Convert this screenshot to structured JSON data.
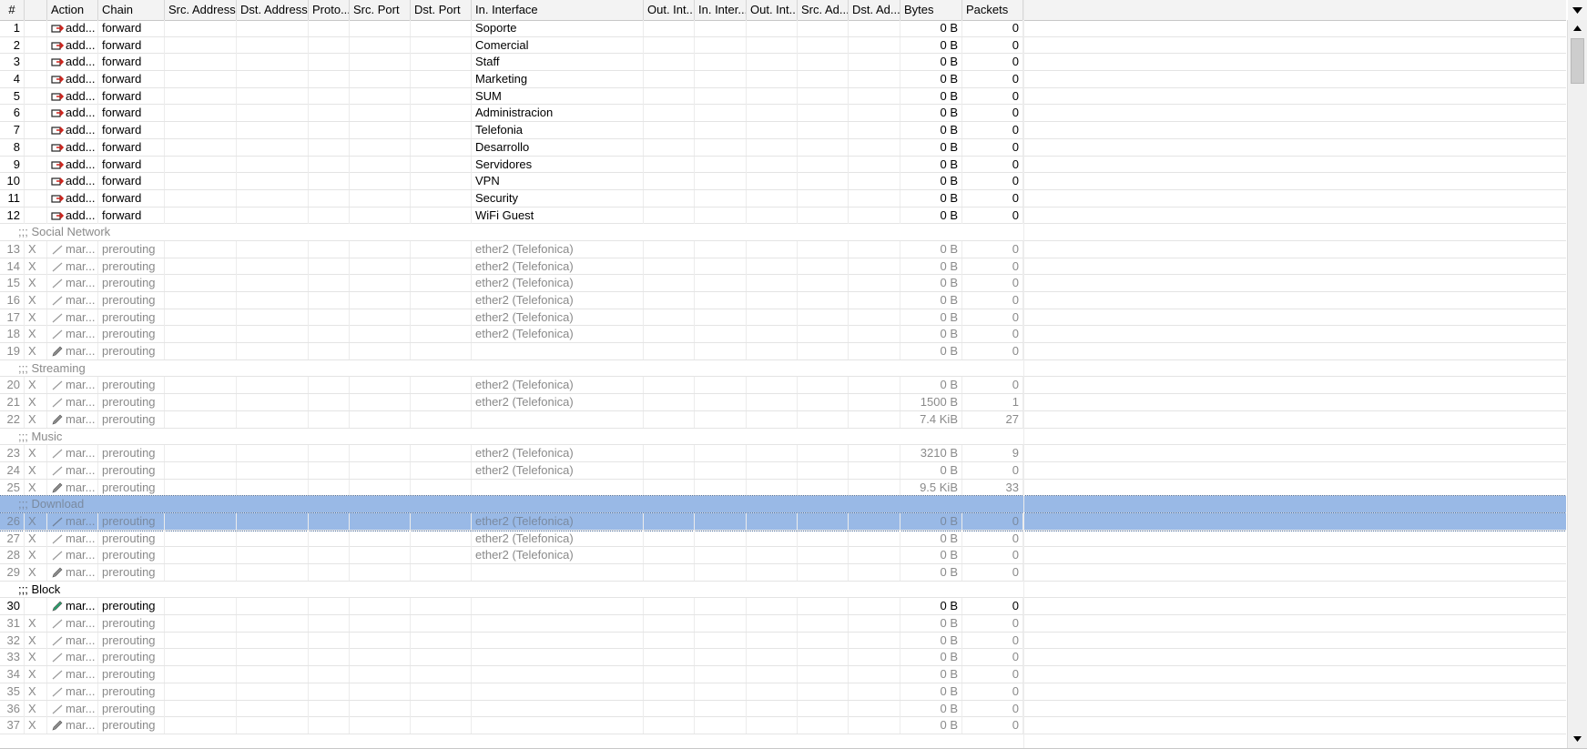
{
  "columns": [
    {
      "key": "num",
      "label": "#"
    },
    {
      "key": "flag",
      "label": ""
    },
    {
      "key": "action",
      "label": "Action"
    },
    {
      "key": "chain",
      "label": "Chain"
    },
    {
      "key": "src_address",
      "label": "Src. Address"
    },
    {
      "key": "dst_address",
      "label": "Dst. Address"
    },
    {
      "key": "proto",
      "label": "Proto..."
    },
    {
      "key": "src_port",
      "label": "Src. Port"
    },
    {
      "key": "dst_port",
      "label": "Dst. Port"
    },
    {
      "key": "in_interface",
      "label": "In. Interface"
    },
    {
      "key": "out_int",
      "label": "Out. Int..."
    },
    {
      "key": "in_inter",
      "label": "In. Inter..."
    },
    {
      "key": "out_int2",
      "label": "Out. Int..."
    },
    {
      "key": "src_ad",
      "label": "Src. Ad..."
    },
    {
      "key": "dst_ad",
      "label": "Dst. Ad..."
    },
    {
      "key": "bytes",
      "label": "Bytes"
    },
    {
      "key": "packets",
      "label": "Packets"
    }
  ],
  "rows": [
    {
      "type": "rule",
      "num": "1",
      "flag": "",
      "action": "add...",
      "icon": "add-icon",
      "chain": "forward",
      "in_interface": "Soporte",
      "bytes": "0 B",
      "packets": "0",
      "disabled": false
    },
    {
      "type": "rule",
      "num": "2",
      "flag": "",
      "action": "add...",
      "icon": "add-icon",
      "chain": "forward",
      "in_interface": "Comercial",
      "bytes": "0 B",
      "packets": "0",
      "disabled": false
    },
    {
      "type": "rule",
      "num": "3",
      "flag": "",
      "action": "add...",
      "icon": "add-icon",
      "chain": "forward",
      "in_interface": "Staff",
      "bytes": "0 B",
      "packets": "0",
      "disabled": false
    },
    {
      "type": "rule",
      "num": "4",
      "flag": "",
      "action": "add...",
      "icon": "add-icon",
      "chain": "forward",
      "in_interface": "Marketing",
      "bytes": "0 B",
      "packets": "0",
      "disabled": false
    },
    {
      "type": "rule",
      "num": "5",
      "flag": "",
      "action": "add...",
      "icon": "add-icon",
      "chain": "forward",
      "in_interface": "SUM",
      "bytes": "0 B",
      "packets": "0",
      "disabled": false
    },
    {
      "type": "rule",
      "num": "6",
      "flag": "",
      "action": "add...",
      "icon": "add-icon",
      "chain": "forward",
      "in_interface": "Administracion",
      "bytes": "0 B",
      "packets": "0",
      "disabled": false
    },
    {
      "type": "rule",
      "num": "7",
      "flag": "",
      "action": "add...",
      "icon": "add-icon",
      "chain": "forward",
      "in_interface": "Telefonia",
      "bytes": "0 B",
      "packets": "0",
      "disabled": false
    },
    {
      "type": "rule",
      "num": "8",
      "flag": "",
      "action": "add...",
      "icon": "add-icon",
      "chain": "forward",
      "in_interface": "Desarrollo",
      "bytes": "0 B",
      "packets": "0",
      "disabled": false
    },
    {
      "type": "rule",
      "num": "9",
      "flag": "",
      "action": "add...",
      "icon": "add-icon",
      "chain": "forward",
      "in_interface": "Servidores",
      "bytes": "0 B",
      "packets": "0",
      "disabled": false
    },
    {
      "type": "rule",
      "num": "10",
      "flag": "",
      "action": "add...",
      "icon": "add-icon",
      "chain": "forward",
      "in_interface": "VPN",
      "bytes": "0 B",
      "packets": "0",
      "disabled": false
    },
    {
      "type": "rule",
      "num": "11",
      "flag": "",
      "action": "add...",
      "icon": "add-icon",
      "chain": "forward",
      "in_interface": "Security",
      "bytes": "0 B",
      "packets": "0",
      "disabled": false
    },
    {
      "type": "rule",
      "num": "12",
      "flag": "",
      "action": "add...",
      "icon": "add-icon",
      "chain": "forward",
      "in_interface": "WiFi Guest",
      "bytes": "0 B",
      "packets": "0",
      "disabled": false
    },
    {
      "type": "comment",
      "text": ";;; Social Network",
      "disabled": true
    },
    {
      "type": "rule",
      "num": "13",
      "flag": "X",
      "action": "mar...",
      "icon": "mark-icon",
      "chain": "prerouting",
      "in_interface": "ether2 (Telefonica)",
      "bytes": "0 B",
      "packets": "0",
      "disabled": true
    },
    {
      "type": "rule",
      "num": "14",
      "flag": "X",
      "action": "mar...",
      "icon": "mark-icon",
      "chain": "prerouting",
      "in_interface": "ether2 (Telefonica)",
      "bytes": "0 B",
      "packets": "0",
      "disabled": true
    },
    {
      "type": "rule",
      "num": "15",
      "flag": "X",
      "action": "mar...",
      "icon": "mark-icon",
      "chain": "prerouting",
      "in_interface": "ether2 (Telefonica)",
      "bytes": "0 B",
      "packets": "0",
      "disabled": true
    },
    {
      "type": "rule",
      "num": "16",
      "flag": "X",
      "action": "mar...",
      "icon": "mark-icon",
      "chain": "prerouting",
      "in_interface": "ether2 (Telefonica)",
      "bytes": "0 B",
      "packets": "0",
      "disabled": true
    },
    {
      "type": "rule",
      "num": "17",
      "flag": "X",
      "action": "mar...",
      "icon": "mark-icon",
      "chain": "prerouting",
      "in_interface": "ether2 (Telefonica)",
      "bytes": "0 B",
      "packets": "0",
      "disabled": true
    },
    {
      "type": "rule",
      "num": "18",
      "flag": "X",
      "action": "mar...",
      "icon": "mark-icon",
      "chain": "prerouting",
      "in_interface": "ether2 (Telefonica)",
      "bytes": "0 B",
      "packets": "0",
      "disabled": true
    },
    {
      "type": "rule",
      "num": "19",
      "flag": "X",
      "action": "mar...",
      "icon": "pencil-icon",
      "chain": "prerouting",
      "in_interface": "",
      "bytes": "0 B",
      "packets": "0",
      "disabled": true
    },
    {
      "type": "comment",
      "text": ";;; Streaming",
      "disabled": true
    },
    {
      "type": "rule",
      "num": "20",
      "flag": "X",
      "action": "mar...",
      "icon": "mark-icon",
      "chain": "prerouting",
      "in_interface": "ether2 (Telefonica)",
      "bytes": "0 B",
      "packets": "0",
      "disabled": true
    },
    {
      "type": "rule",
      "num": "21",
      "flag": "X",
      "action": "mar...",
      "icon": "mark-icon",
      "chain": "prerouting",
      "in_interface": "ether2 (Telefonica)",
      "bytes": "1500 B",
      "packets": "1",
      "disabled": true
    },
    {
      "type": "rule",
      "num": "22",
      "flag": "X",
      "action": "mar...",
      "icon": "pencil-icon",
      "chain": "prerouting",
      "in_interface": "",
      "bytes": "7.4 KiB",
      "packets": "27",
      "disabled": true
    },
    {
      "type": "comment",
      "text": ";;; Music",
      "disabled": true
    },
    {
      "type": "rule",
      "num": "23",
      "flag": "X",
      "action": "mar...",
      "icon": "mark-icon",
      "chain": "prerouting",
      "in_interface": "ether2 (Telefonica)",
      "bytes": "3210 B",
      "packets": "9",
      "disabled": true
    },
    {
      "type": "rule",
      "num": "24",
      "flag": "X",
      "action": "mar...",
      "icon": "mark-icon",
      "chain": "prerouting",
      "in_interface": "ether2 (Telefonica)",
      "bytes": "0 B",
      "packets": "0",
      "disabled": true
    },
    {
      "type": "rule",
      "num": "25",
      "flag": "X",
      "action": "mar...",
      "icon": "pencil-icon",
      "chain": "prerouting",
      "in_interface": "",
      "bytes": "9.5 KiB",
      "packets": "33",
      "disabled": true
    },
    {
      "type": "comment",
      "text": ";;; Download",
      "disabled": true,
      "selected": true
    },
    {
      "type": "rule",
      "num": "26",
      "flag": "X",
      "action": "mar...",
      "icon": "mark-icon",
      "chain": "prerouting",
      "in_interface": "ether2 (Telefonica)",
      "bytes": "0 B",
      "packets": "0",
      "disabled": true,
      "selected": true
    },
    {
      "type": "rule",
      "num": "27",
      "flag": "X",
      "action": "mar...",
      "icon": "mark-icon",
      "chain": "prerouting",
      "in_interface": "ether2 (Telefonica)",
      "bytes": "0 B",
      "packets": "0",
      "disabled": true
    },
    {
      "type": "rule",
      "num": "28",
      "flag": "X",
      "action": "mar...",
      "icon": "mark-icon",
      "chain": "prerouting",
      "in_interface": "ether2 (Telefonica)",
      "bytes": "0 B",
      "packets": "0",
      "disabled": true
    },
    {
      "type": "rule",
      "num": "29",
      "flag": "X",
      "action": "mar...",
      "icon": "pencil-icon",
      "chain": "prerouting",
      "in_interface": "",
      "bytes": "0 B",
      "packets": "0",
      "disabled": true
    },
    {
      "type": "comment",
      "text": ";;; Block",
      "disabled": false
    },
    {
      "type": "rule",
      "num": "30",
      "flag": "",
      "action": "mar...",
      "icon": "pencil-icon",
      "chain": "prerouting",
      "in_interface": "",
      "bytes": "0 B",
      "packets": "0",
      "disabled": false
    },
    {
      "type": "rule",
      "num": "31",
      "flag": "X",
      "action": "mar...",
      "icon": "mark-icon",
      "chain": "prerouting",
      "in_interface": "",
      "bytes": "0 B",
      "packets": "0",
      "disabled": true
    },
    {
      "type": "rule",
      "num": "32",
      "flag": "X",
      "action": "mar...",
      "icon": "mark-icon",
      "chain": "prerouting",
      "in_interface": "",
      "bytes": "0 B",
      "packets": "0",
      "disabled": true
    },
    {
      "type": "rule",
      "num": "33",
      "flag": "X",
      "action": "mar...",
      "icon": "mark-icon",
      "chain": "prerouting",
      "in_interface": "",
      "bytes": "0 B",
      "packets": "0",
      "disabled": true
    },
    {
      "type": "rule",
      "num": "34",
      "flag": "X",
      "action": "mar...",
      "icon": "mark-icon",
      "chain": "prerouting",
      "in_interface": "",
      "bytes": "0 B",
      "packets": "0",
      "disabled": true
    },
    {
      "type": "rule",
      "num": "35",
      "flag": "X",
      "action": "mar...",
      "icon": "mark-icon",
      "chain": "prerouting",
      "in_interface": "",
      "bytes": "0 B",
      "packets": "0",
      "disabled": true
    },
    {
      "type": "rule",
      "num": "36",
      "flag": "X",
      "action": "mar...",
      "icon": "mark-icon",
      "chain": "prerouting",
      "in_interface": "",
      "bytes": "0 B",
      "packets": "0",
      "disabled": true
    },
    {
      "type": "rule",
      "num": "37",
      "flag": "X",
      "action": "mar...",
      "icon": "pencil-icon",
      "chain": "prerouting",
      "in_interface": "",
      "bytes": "0 B",
      "packets": "0",
      "disabled": true
    }
  ],
  "colors": {
    "selected_row": "#99b9e6",
    "disabled_text": "#8a8a8a",
    "add_icon_red": "#d0221b",
    "pencil_green": "#2a9d6a"
  },
  "icons": {
    "scroll_up": "scroll-up-arrow-icon",
    "scroll_down": "scroll-down-arrow-icon",
    "column_menu": "column-menu-arrow-icon"
  }
}
